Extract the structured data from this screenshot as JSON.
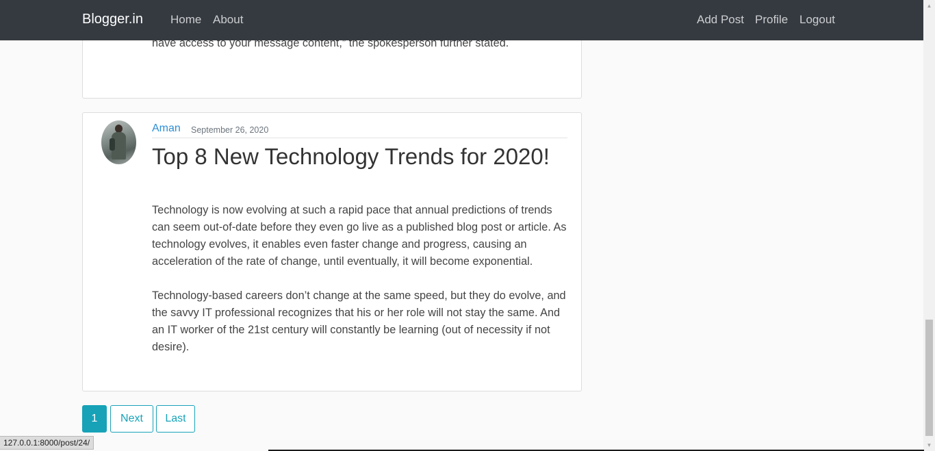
{
  "navbar": {
    "brand": "Blogger.in",
    "links_left": [
      "Home",
      "About"
    ],
    "links_right": [
      "Add Post",
      "Profile",
      "Logout"
    ]
  },
  "previous_post": {
    "visible_text": "people sign up on WhatsApp using only a phone number, and WhatsApp doesn’t have access to your message content,” the spokesperson further stated."
  },
  "post": {
    "author": "Aman",
    "date": "September 26, 2020",
    "title": "Top 8 New Technology Trends for 2020!",
    "body": "Technology is now evolving at such a rapid pace that annual predictions of trends can seem out-of-date before they even go live as a published blog post or article. As technology evolves, it enables even faster change and progress, causing an acceleration of the rate of change, until eventually, it will become exponential.\n\nTechnology-based careers don’t change at the same speed, but they do evolve, and the savvy IT professional recognizes that his or her role will not stay the same. And an IT worker of the 21st century will constantly be learning (out of necessity if not desire)."
  },
  "pagination": {
    "current": "1",
    "next": "Next",
    "last": "Last"
  },
  "status_bar": {
    "url": "127.0.0.1:8000/post/24/"
  },
  "colors": {
    "navbar_bg": "#343a40",
    "accent": "#17a2b8",
    "author_link": "#2d8ed2"
  }
}
